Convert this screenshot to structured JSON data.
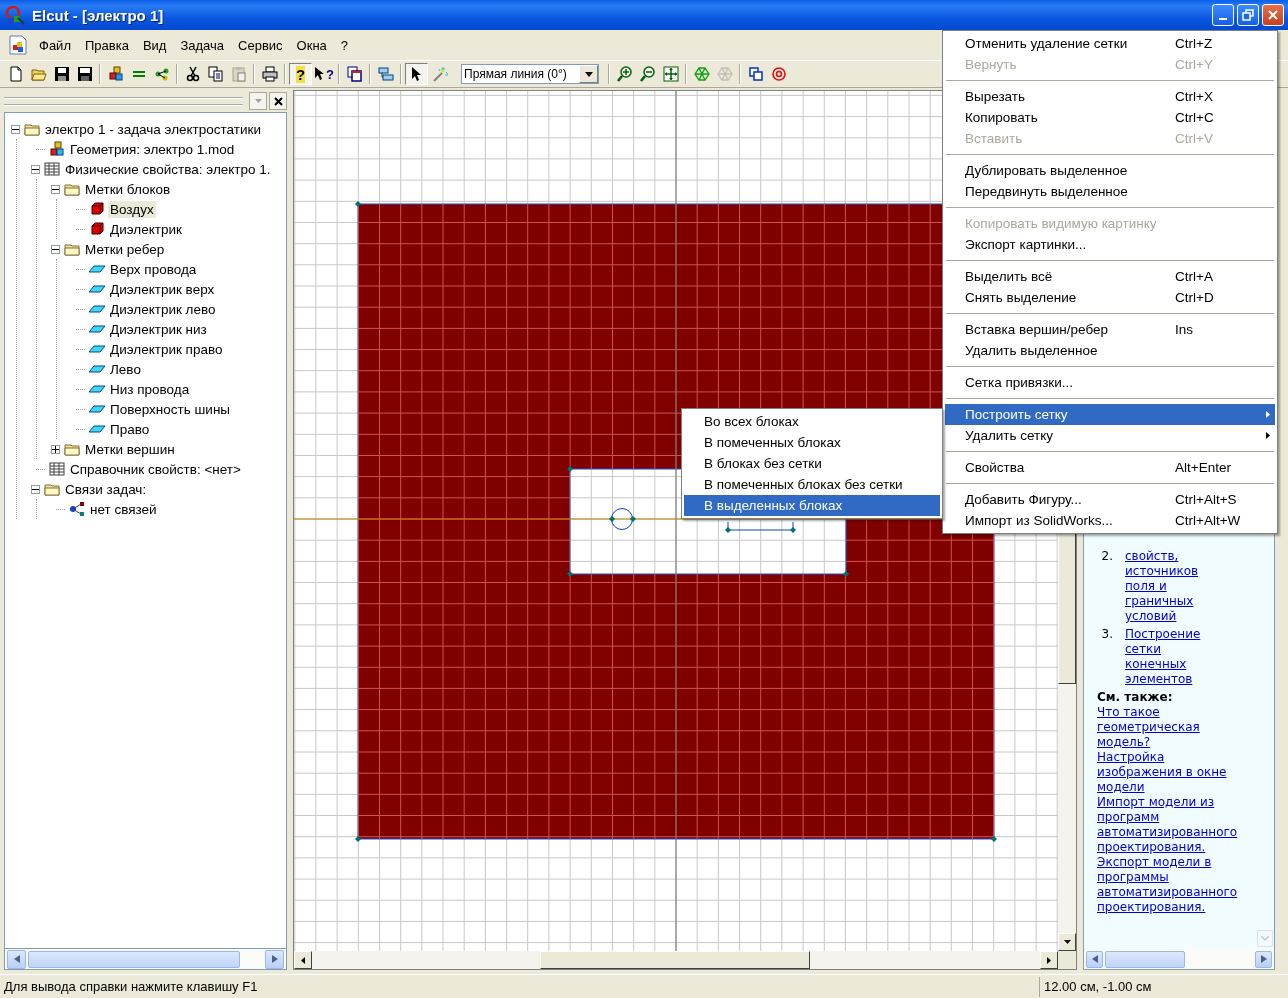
{
  "window": {
    "title": "Elcut - [электро 1]"
  },
  "menubar": [
    "Файл",
    "Правка",
    "Вид",
    "Задача",
    "Сервис",
    "Окна",
    "?"
  ],
  "toolbar": {
    "buttons": [
      {
        "pressed": false,
        "disabled": false
      },
      {
        "pressed": false,
        "disabled": false
      },
      {
        "pressed": false,
        "disabled": false
      },
      {
        "pressed": false,
        "disabled": false
      },
      {
        "pressed": false,
        "disabled": false
      },
      {
        "pressed": false,
        "disabled": false
      },
      {
        "pressed": false,
        "disabled": false
      },
      {
        "pressed": false,
        "disabled": false
      },
      {
        "pressed": false,
        "disabled": false
      },
      {
        "pressed": false,
        "disabled": true
      },
      {
        "pressed": false,
        "disabled": false
      },
      {
        "pressed": true,
        "disabled": false,
        "label": "?"
      },
      {
        "pressed": false,
        "disabled": false,
        "label": "?"
      },
      {
        "pressed": false,
        "disabled": false
      },
      {
        "pressed": false,
        "disabled": false
      },
      {
        "pressed": true,
        "disabled": false
      },
      {
        "pressed": false,
        "disabled": false
      },
      {
        "pressed": false,
        "disabled": false
      },
      {
        "pressed": false,
        "disabled": false
      },
      {
        "pressed": false,
        "disabled": false
      },
      {
        "pressed": false,
        "disabled": false
      },
      {
        "pressed": false,
        "disabled": true
      },
      {
        "pressed": false,
        "disabled": false
      },
      {
        "pressed": false,
        "disabled": false
      }
    ],
    "line_type": "Прямая линия (0°)"
  },
  "tree": [
    {
      "label": "электро 1 - задача электростатики",
      "kind": "folder",
      "expanded": true,
      "selected": false,
      "children": [
        {
          "label": "Геометрия: электро 1.mod",
          "kind": "geometry",
          "selected": false
        },
        {
          "label": "Физические свойства: электро 1.",
          "kind": "table",
          "expanded": true,
          "selected": false,
          "children": [
            {
              "label": "Метки блоков",
              "kind": "folder",
              "expanded": true,
              "selected": false,
              "children": [
                {
                  "label": "Воздух",
                  "kind": "block-label",
                  "selected": true
                },
                {
                  "label": "Диэлектрик",
                  "kind": "block-label",
                  "selected": false
                }
              ]
            },
            {
              "label": "Метки ребер",
              "kind": "folder",
              "expanded": true,
              "selected": false,
              "children": [
                {
                  "label": "Верх провода",
                  "kind": "edge-label",
                  "selected": false
                },
                {
                  "label": "Диэлектрик верх",
                  "kind": "edge-label",
                  "selected": false
                },
                {
                  "label": "Диэлектрик лево",
                  "kind": "edge-label",
                  "selected": false
                },
                {
                  "label": "Диэлектрик низ",
                  "kind": "edge-label",
                  "selected": false
                },
                {
                  "label": "Диэлектрик право",
                  "kind": "edge-label",
                  "selected": false
                },
                {
                  "label": "Лево",
                  "kind": "edge-label",
                  "selected": false
                },
                {
                  "label": "Низ провода",
                  "kind": "edge-label",
                  "selected": false
                },
                {
                  "label": "Поверхность шины",
                  "kind": "edge-label",
                  "selected": false
                },
                {
                  "label": "Право",
                  "kind": "edge-label",
                  "selected": false
                }
              ]
            },
            {
              "label": "Метки вершин",
              "kind": "folder",
              "expanded": false,
              "selected": false
            }
          ]
        },
        {
          "label": "Справочник свойств: <нет>",
          "kind": "table",
          "selected": false
        },
        {
          "label": "Связи задач:",
          "kind": "folder",
          "expanded": true,
          "selected": false,
          "children": [
            {
              "label": "нет связей",
              "kind": "link",
              "selected": false
            }
          ]
        }
      ]
    }
  ],
  "context_menu": [
    {
      "kind": "item",
      "label": "Отменить удаление сетки",
      "shortcut": "Ctrl+Z",
      "disabled": false,
      "selected": false,
      "has_submenu": false
    },
    {
      "kind": "item",
      "label": "Вернуть",
      "shortcut": "Ctrl+Y",
      "disabled": true,
      "selected": false,
      "has_submenu": false
    },
    {
      "kind": "separator"
    },
    {
      "kind": "item",
      "label": "Вырезать",
      "shortcut": "Ctrl+X",
      "disabled": false,
      "selected": false,
      "has_submenu": false
    },
    {
      "kind": "item",
      "label": "Копировать",
      "shortcut": "Ctrl+C",
      "disabled": false,
      "selected": false,
      "has_submenu": false
    },
    {
      "kind": "item",
      "label": "Вставить",
      "shortcut": "Ctrl+V",
      "disabled": true,
      "selected": false,
      "has_submenu": false
    },
    {
      "kind": "separator"
    },
    {
      "kind": "item",
      "label": "Дублировать выделенное",
      "disabled": false,
      "selected": false,
      "has_submenu": false
    },
    {
      "kind": "item",
      "label": "Передвинуть выделенное",
      "disabled": false,
      "selected": false,
      "has_submenu": false
    },
    {
      "kind": "separator"
    },
    {
      "kind": "item",
      "label": "Копировать видимую картинку",
      "disabled": true,
      "selected": false,
      "has_submenu": false
    },
    {
      "kind": "item",
      "label": "Экспорт картинки...",
      "disabled": false,
      "selected": false,
      "has_submenu": false
    },
    {
      "kind": "separator"
    },
    {
      "kind": "item",
      "label": "Выделить всё",
      "shortcut": "Ctrl+A",
      "disabled": false,
      "selected": false,
      "has_submenu": false
    },
    {
      "kind": "item",
      "label": "Снять выделение",
      "shortcut": "Ctrl+D",
      "disabled": false,
      "selected": false,
      "has_submenu": false
    },
    {
      "kind": "separator"
    },
    {
      "kind": "item",
      "label": "Вставка вершин/ребер",
      "shortcut": "Ins",
      "disabled": false,
      "selected": false,
      "has_submenu": false
    },
    {
      "kind": "item",
      "label": "Удалить выделенное",
      "disabled": false,
      "selected": false,
      "has_submenu": false
    },
    {
      "kind": "separator"
    },
    {
      "kind": "item",
      "label": "Сетка привязки...",
      "disabled": false,
      "selected": false,
      "has_submenu": false
    },
    {
      "kind": "separator"
    },
    {
      "kind": "item",
      "label": "Построить сетку",
      "disabled": false,
      "selected": true,
      "has_submenu": true
    },
    {
      "kind": "item",
      "label": "Удалить сетку",
      "disabled": false,
      "selected": false,
      "has_submenu": true
    },
    {
      "kind": "separator"
    },
    {
      "kind": "item",
      "label": "Свойства",
      "shortcut": "Alt+Enter",
      "disabled": false,
      "selected": false,
      "has_submenu": false
    },
    {
      "kind": "separator"
    },
    {
      "kind": "item",
      "label": "Добавить Фигуру...",
      "shortcut": "Ctrl+Alt+S",
      "disabled": false,
      "selected": false,
      "has_submenu": false
    },
    {
      "kind": "item",
      "label": "Импорт из SolidWorks...",
      "shortcut": "Ctrl+Alt+W",
      "disabled": false,
      "selected": false,
      "has_submenu": false
    }
  ],
  "submenu": [
    {
      "label": "Во всех блоках",
      "selected": false
    },
    {
      "label": "В помеченных блоках",
      "selected": false
    },
    {
      "label": "В блоках без сетки",
      "selected": false
    },
    {
      "label": "В помеченных блоках без сетки",
      "selected": false
    },
    {
      "label": "В выделенных блоках",
      "selected": true
    }
  ],
  "help": {
    "steps": [
      {
        "number": "2.",
        "link": "свойств, источников поля и граничных условий"
      },
      {
        "number": "3.",
        "link": "Построение сетки конечных элементов"
      }
    ],
    "see_also_title": "См. также:",
    "links": [
      "Что такое геометрическая модель?",
      "Настройка изображения в окне модели",
      "Импорт модели из программ автоматизированного проектирования.",
      "Экспорт модели в программы автоматизированного проектирования."
    ]
  },
  "status_bar": {
    "message": "Для вывода справки нажмите клавишу F1",
    "coordinates": "12.00 см, -1.00 см"
  }
}
